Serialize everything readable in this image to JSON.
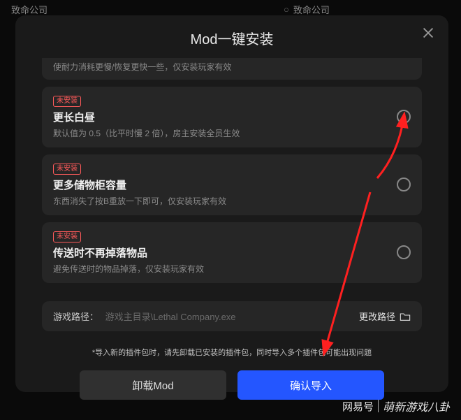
{
  "background": {
    "tab1": "致命公司",
    "tab2": "致命公司"
  },
  "modal": {
    "title": "Mod一键安装",
    "partial_desc": "使耐力消耗更慢/恢复更快一些，仅安装玩家有效",
    "mods": [
      {
        "tag": "未安装",
        "name": "更长白昼",
        "desc": "默认值为 0.5（比平时慢 2 倍），房主安装全员生效"
      },
      {
        "tag": "未安装",
        "name": "更多储物柜容量",
        "desc": "东西消失了按B重放一下即可，仅安装玩家有效"
      },
      {
        "tag": "未安装",
        "name": "传送时不再掉落物品",
        "desc": "避免传送时的物品掉落，仅安装玩家有效"
      }
    ],
    "path": {
      "label": "游戏路径：",
      "value": "游戏主目录\\Lethal Company.exe",
      "change": "更改路径"
    },
    "warning": "*导入新的插件包时，请先卸载已安装的插件包，同时导入多个插件包可能出现问题",
    "buttons": {
      "uninstall": "卸载Mod",
      "confirm": "确认导入"
    }
  },
  "watermark": {
    "left": "网易号",
    "right": "萌新游戏八卦"
  }
}
